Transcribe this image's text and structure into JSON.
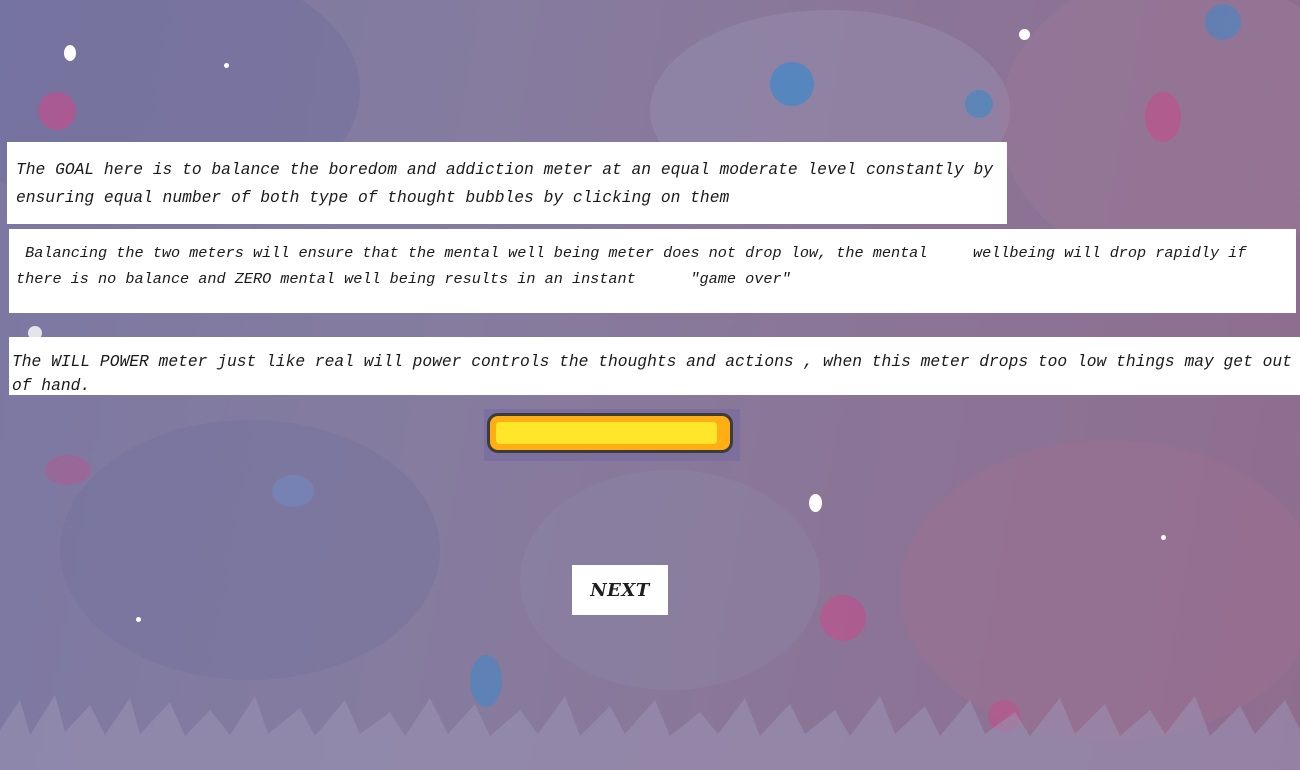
{
  "panels": {
    "goal": "The GOAL here is to balance the boredom and addiction meter at an equal moderate level constantly by ensuring equal number of both type of thought bubbles by clicking on them",
    "balance": " Balancing the two meters will ensure that the mental well being meter does not drop low, the mental     wellbeing will drop rapidly if there is no balance and ZERO mental well being results in an instant      \"game over\"",
    "willpower": "The WILL POWER meter just like real will power controls the thoughts and actions , when this meter drops too low things may get out of hand."
  },
  "willpower_meter": {
    "level": 0.97,
    "fill_color": "#ffe62a",
    "track_color": "#ffae14",
    "border_color": "#3c3c3c"
  },
  "buttons": {
    "next_label": "NEXT"
  },
  "colors": {
    "background_left": "#7c78a3",
    "background_right": "#8f6d8f",
    "panel": "#ffffff"
  }
}
